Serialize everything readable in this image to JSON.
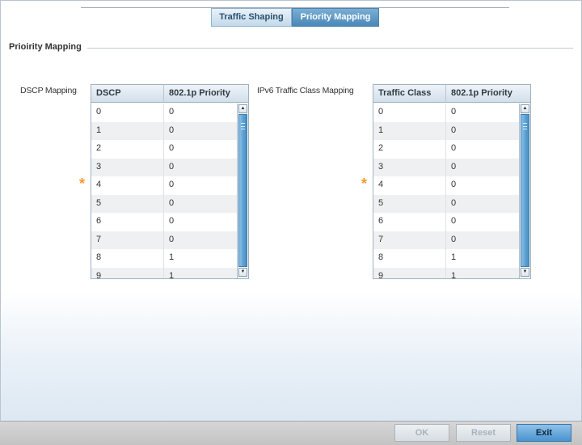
{
  "tabs": [
    {
      "label": "Traffic Shaping",
      "active": false
    },
    {
      "label": "Priority Mapping",
      "active": true
    }
  ],
  "section": {
    "title": "Prioirity Mapping"
  },
  "dscp": {
    "label": "DSCP Mapping",
    "columns": [
      "DSCP",
      "802.1p Priority"
    ],
    "rows": [
      [
        "0",
        "0"
      ],
      [
        "1",
        "0"
      ],
      [
        "2",
        "0"
      ],
      [
        "3",
        "0"
      ],
      [
        "4",
        "0"
      ],
      [
        "5",
        "0"
      ],
      [
        "6",
        "0"
      ],
      [
        "7",
        "0"
      ],
      [
        "8",
        "1"
      ],
      [
        "9",
        "1"
      ]
    ]
  },
  "ipv6": {
    "label": "IPv6 Traffic Class Mapping",
    "columns": [
      "Traffic Class",
      "802.1p Priority"
    ],
    "rows": [
      [
        "0",
        "0"
      ],
      [
        "1",
        "0"
      ],
      [
        "2",
        "0"
      ],
      [
        "3",
        "0"
      ],
      [
        "4",
        "0"
      ],
      [
        "5",
        "0"
      ],
      [
        "6",
        "0"
      ],
      [
        "7",
        "0"
      ],
      [
        "8",
        "1"
      ],
      [
        "9",
        "1"
      ]
    ]
  },
  "required_marker": "*",
  "footer": {
    "ok": "OK",
    "reset": "Reset",
    "exit": "Exit"
  },
  "colors": {
    "accent": "#4a88b9",
    "required": "#f39a2e"
  }
}
